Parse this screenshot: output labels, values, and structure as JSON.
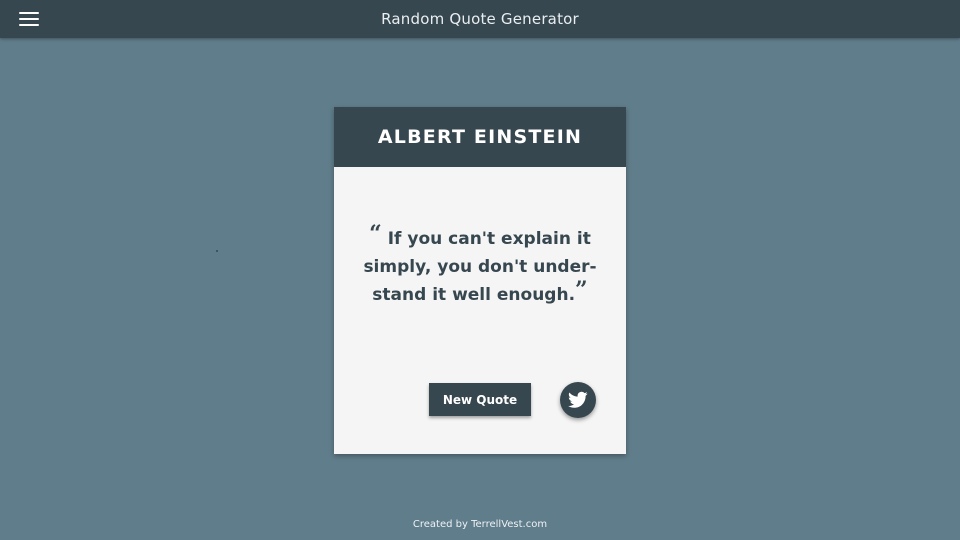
{
  "appbar": {
    "title": "Random Quote Generator",
    "menu_icon": "hamburger-menu-icon"
  },
  "card": {
    "author": "ALBERT EINSTEIN",
    "quote_open": "“",
    "quote_text": "If you can't explain it simply, you don't under-stand it well enough.",
    "quote_close": "”",
    "new_quote_label": "New Quote",
    "share_icon": "twitter-icon"
  },
  "footer": {
    "credit": "Created by TerrellVest.com"
  },
  "colors": {
    "background": "#607d8b",
    "primary_dark": "#37474f",
    "card_surface": "#f5f5f5",
    "text_light": "#ffffff"
  }
}
